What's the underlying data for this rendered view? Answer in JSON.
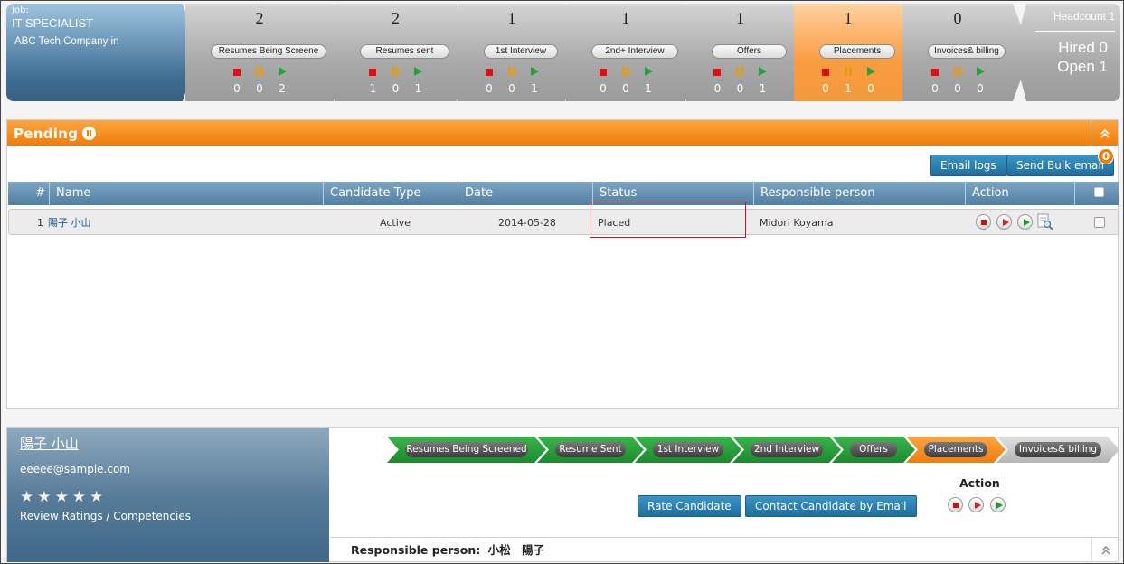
{
  "job": {
    "label": "Job:",
    "title": "IT SPECIALIST",
    "company": "ABC Tech Company in"
  },
  "stages": [
    {
      "label": "Resumes Being Screene",
      "count": "2",
      "stopped": "0",
      "paused": "0",
      "active": "2",
      "highlight": false
    },
    {
      "label": "Resumes sent",
      "count": "2",
      "stopped": "1",
      "paused": "0",
      "active": "1",
      "highlight": false
    },
    {
      "label": "1st Interview",
      "count": "1",
      "stopped": "0",
      "paused": "0",
      "active": "1",
      "highlight": false
    },
    {
      "label": "2nd+ Interview",
      "count": "1",
      "stopped": "0",
      "paused": "0",
      "active": "1",
      "highlight": false
    },
    {
      "label": "Offers",
      "count": "1",
      "stopped": "0",
      "paused": "0",
      "active": "1",
      "highlight": false
    },
    {
      "label": "Placements",
      "count": "1",
      "stopped": "0",
      "paused": "1",
      "active": "0",
      "highlight": true
    },
    {
      "label": "Invoices& billing",
      "count": "0",
      "stopped": "0",
      "paused": "0",
      "active": "0",
      "highlight": false
    }
  ],
  "headcount": {
    "label": "Headcount 1",
    "hired": "Hired 0",
    "open": "Open 1"
  },
  "pending": {
    "title": "Pending",
    "collapse_icon": "double-chevron-up-icon",
    "email_logs_label": "Email logs",
    "bulk_email_label": "Send Bulk email",
    "bulk_email_badge": "0",
    "columns": [
      "#",
      "Name",
      "Candidate Type",
      "Date",
      "Status",
      "Responsible person",
      "Action"
    ],
    "rows": [
      {
        "num": "1",
        "name": "陽子 小山",
        "type": "Active",
        "date": "2014-05-28",
        "status": "Placed",
        "responsible": "Midori Koyama"
      }
    ]
  },
  "candidate": {
    "name": "陽子 小山",
    "email": "eeeee@sample.com",
    "stars": [
      "★",
      "★",
      "★",
      "★",
      "★"
    ],
    "review_ratings": "Review Ratings",
    "separator": "/",
    "competencies": "Competencies"
  },
  "steps": [
    {
      "label": "Resumes Being Screened",
      "state": "done"
    },
    {
      "label": "Resume Sent",
      "state": "done"
    },
    {
      "label": "1st Interview",
      "state": "done"
    },
    {
      "label": "2nd Interview",
      "state": "done"
    },
    {
      "label": "Offers",
      "state": "done"
    },
    {
      "label": "Placements",
      "state": "current"
    },
    {
      "label": "Invoices& billing",
      "state": "todo"
    }
  ],
  "detail": {
    "rate_label": "Rate Candidate",
    "contact_label": "Contact Candidate by Email",
    "action_label": "Action",
    "responsible_label": "Responsible person:",
    "responsible_value": "小松　陽子"
  },
  "colors": {
    "accent_orange": "#f07d0a",
    "header_blue": "#4f7fa3",
    "button_blue": "#1f6e9d",
    "step_green": "#1c8a2e",
    "highlight_red": "#b51b1b"
  }
}
